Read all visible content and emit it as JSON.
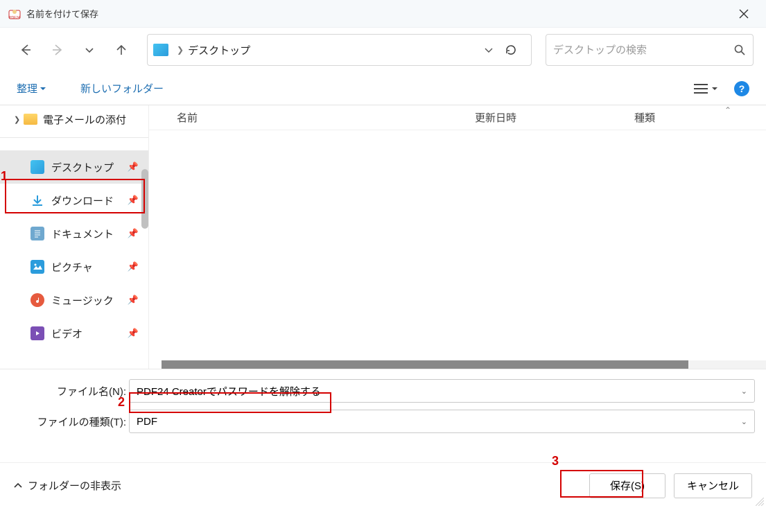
{
  "window": {
    "title": "名前を付けて保存"
  },
  "breadcrumb": {
    "location": "デスクトップ"
  },
  "search": {
    "placeholder": "デスクトップの検索"
  },
  "toolbar": {
    "organize": "整理",
    "new_folder": "新しいフォルダー"
  },
  "tree": {
    "email_attachments": "電子メールの添付"
  },
  "sidebar": {
    "items": [
      {
        "label": "デスクトップ",
        "icon": "desktop",
        "selected": true
      },
      {
        "label": "ダウンロード",
        "icon": "download",
        "selected": false
      },
      {
        "label": "ドキュメント",
        "icon": "document",
        "selected": false
      },
      {
        "label": "ピクチャ",
        "icon": "pictures",
        "selected": false
      },
      {
        "label": "ミュージック",
        "icon": "music",
        "selected": false
      },
      {
        "label": "ビデオ",
        "icon": "video",
        "selected": false
      }
    ]
  },
  "columns": {
    "name": "名前",
    "modified": "更新日時",
    "type": "種類"
  },
  "fields": {
    "filename_label": "ファイル名(N):",
    "filename_value": "PDF24 Creatorでパスワードを解除する",
    "filetype_label": "ファイルの種類(T):",
    "filetype_value": "PDF"
  },
  "footer": {
    "hide_folders": "フォルダーの非表示",
    "save": "保存(S)",
    "cancel": "キャンセル"
  },
  "annotations": {
    "one": "1",
    "two": "2",
    "three": "3"
  }
}
